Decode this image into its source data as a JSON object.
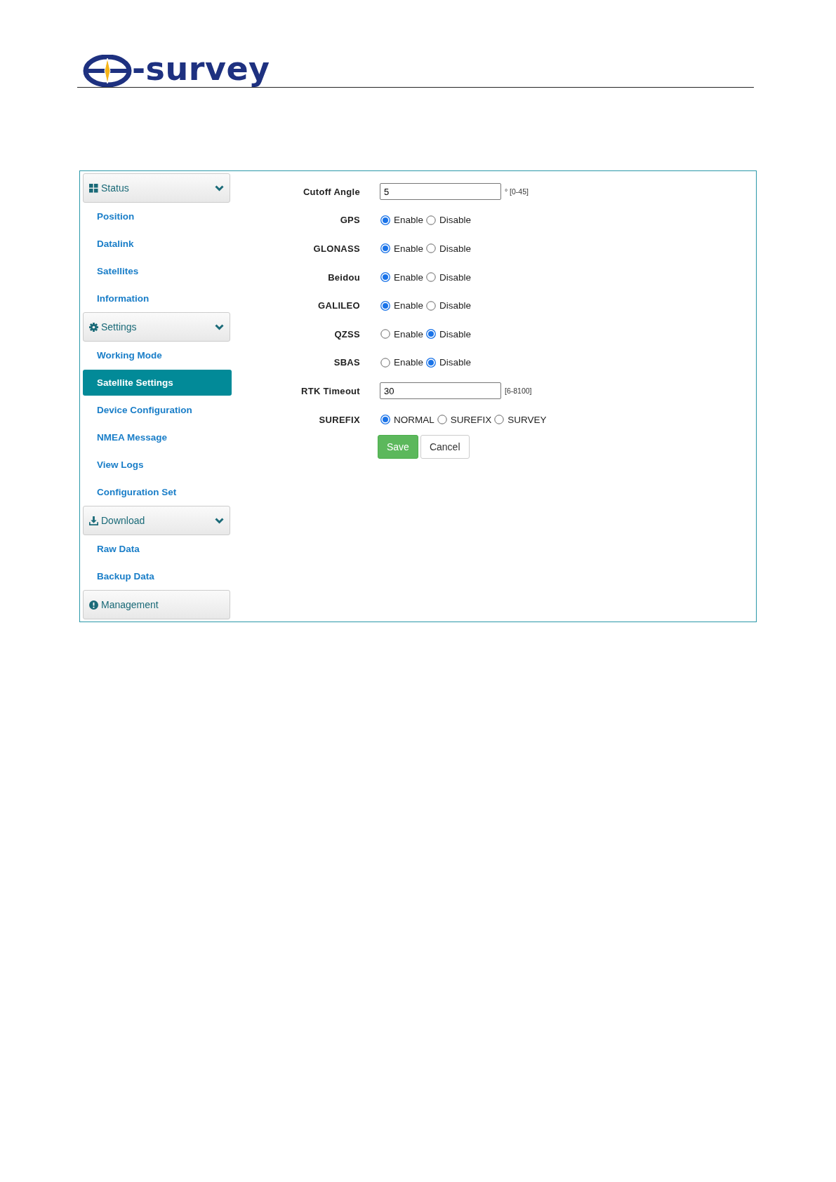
{
  "header": {
    "logo_text": "-survey"
  },
  "sidebar": {
    "groups": [
      {
        "label": "Status",
        "expanded": true,
        "items": [
          {
            "label": "Position",
            "selected": false
          },
          {
            "label": "Datalink",
            "selected": false
          },
          {
            "label": "Satellites",
            "selected": false
          },
          {
            "label": "Information",
            "selected": false
          }
        ]
      },
      {
        "label": "Settings",
        "expanded": true,
        "items": [
          {
            "label": "Working Mode",
            "selected": false
          },
          {
            "label": "Satellite Settings",
            "selected": true
          },
          {
            "label": "Device Configuration",
            "selected": false
          },
          {
            "label": "NMEA Message",
            "selected": false
          },
          {
            "label": "View Logs",
            "selected": false
          },
          {
            "label": "Configuration Set",
            "selected": false
          }
        ]
      },
      {
        "label": "Download",
        "expanded": true,
        "items": [
          {
            "label": "Raw Data",
            "selected": false
          },
          {
            "label": "Backup Data",
            "selected": false
          }
        ]
      },
      {
        "label": "Management",
        "expanded": false
      }
    ]
  },
  "form": {
    "rows": [
      {
        "kind": "input",
        "label": "Cutoff Angle",
        "value": "5",
        "hint": "° [0-45]"
      },
      {
        "kind": "radio",
        "label": "GPS",
        "options": [
          {
            "label": "Enable",
            "selected": true
          },
          {
            "label": "Disable",
            "selected": false
          }
        ]
      },
      {
        "kind": "radio",
        "label": "GLONASS",
        "options": [
          {
            "label": "Enable",
            "selected": true
          },
          {
            "label": "Disable",
            "selected": false
          }
        ]
      },
      {
        "kind": "radio",
        "label": "Beidou",
        "options": [
          {
            "label": "Enable",
            "selected": true
          },
          {
            "label": "Disable",
            "selected": false
          }
        ]
      },
      {
        "kind": "radio",
        "label": "GALILEO",
        "options": [
          {
            "label": "Enable",
            "selected": true
          },
          {
            "label": "Disable",
            "selected": false
          }
        ]
      },
      {
        "kind": "radio",
        "label": "QZSS",
        "options": [
          {
            "label": "Enable",
            "selected": false
          },
          {
            "label": "Disable",
            "selected": true
          }
        ]
      },
      {
        "kind": "radio",
        "label": "SBAS",
        "options": [
          {
            "label": "Enable",
            "selected": false
          },
          {
            "label": "Disable",
            "selected": true
          }
        ]
      },
      {
        "kind": "input",
        "label": "RTK Timeout",
        "value": "30",
        "hint": "[6-8100]"
      },
      {
        "kind": "radio",
        "label": "SUREFIX",
        "options": [
          {
            "label": "NORMAL",
            "selected": true
          },
          {
            "label": "SUREFIX",
            "selected": false
          },
          {
            "label": "SURVEY",
            "selected": false
          }
        ]
      }
    ],
    "buttons": [
      {
        "label": "Save",
        "kind": "primary"
      },
      {
        "label": "Cancel",
        "kind": "default"
      }
    ]
  }
}
